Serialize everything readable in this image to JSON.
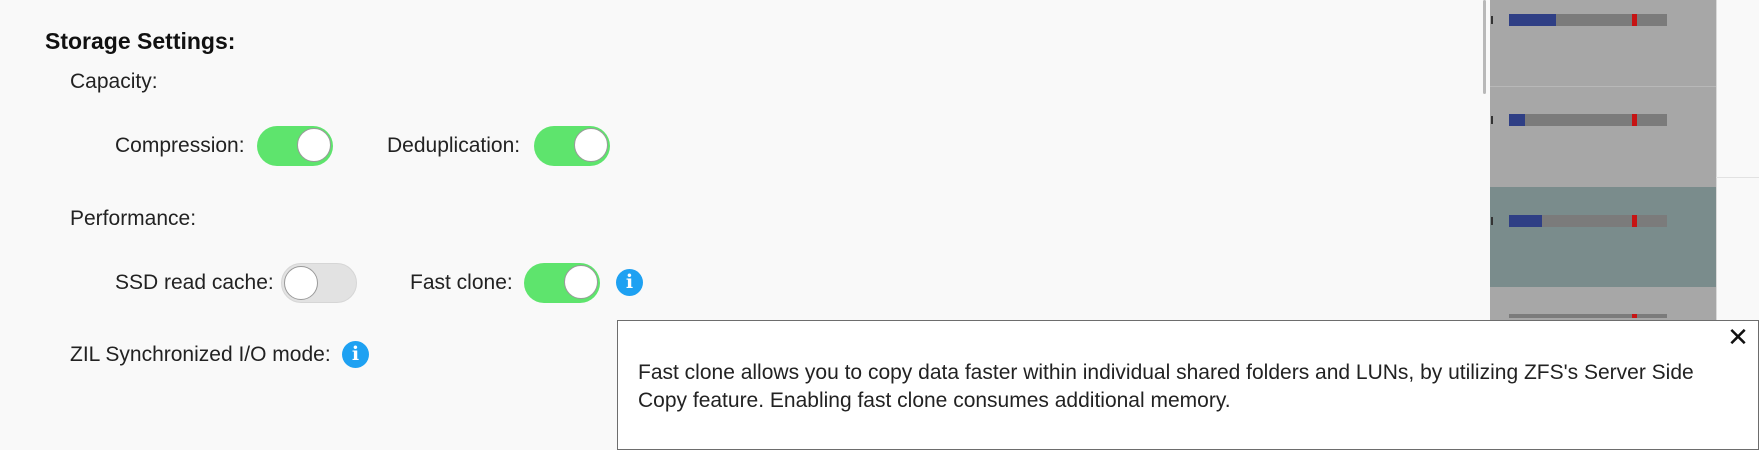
{
  "storage": {
    "title": "Storage Settings:",
    "capacity": {
      "label": "Capacity:",
      "compression": {
        "label": "Compression:",
        "enabled": true
      },
      "deduplication": {
        "label": "Deduplication:",
        "enabled": true
      }
    },
    "performance": {
      "label": "Performance:",
      "ssd_read_cache": {
        "label": "SSD read cache:",
        "enabled": false
      },
      "fast_clone": {
        "label": "Fast clone:",
        "enabled": true
      }
    },
    "zil": {
      "label": "ZIL Synchronized I/O mode:"
    }
  },
  "info_icon": {
    "glyph": "i",
    "icon": "info-icon"
  },
  "tooltip": {
    "text": "Fast clone allows you to copy data faster within individual shared folders and LUNs, by utilizing ZFS's Server Side Copy feature. Enabling fast clone consumes additional memory.",
    "close_glyph": "✕"
  },
  "background_usage_bars": [
    {
      "used_fraction": 0.3,
      "threshold_fraction": 0.8
    },
    {
      "used_fraction": 0.1,
      "threshold_fraction": 0.8
    },
    {
      "used_fraction": 0.21,
      "threshold_fraction": 0.8
    },
    {
      "used_fraction": 0.0,
      "threshold_fraction": 0.8
    }
  ],
  "colors": {
    "toggle_on": "#5ee46d",
    "toggle_off": "#e2e2e2",
    "info_blue": "#1ea1f2",
    "usage_fill": "#2f3f85",
    "usage_threshold": "#c71414"
  }
}
